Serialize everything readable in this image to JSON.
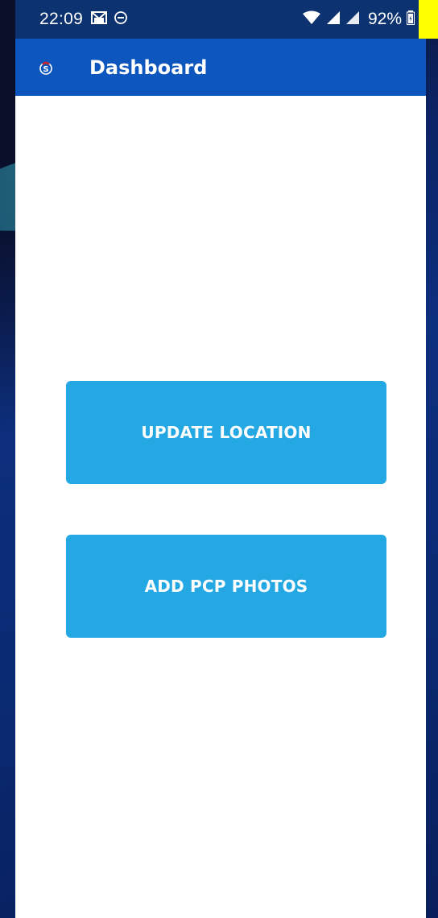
{
  "status_bar": {
    "time": "22:09",
    "battery": "92%",
    "icons": [
      "gmail-icon",
      "messenger-icon",
      "wifi-icon",
      "signal-icon",
      "signal-icon",
      "battery-icon"
    ]
  },
  "app_bar": {
    "title": "Dashboard",
    "logo_icon": "app-logo-icon",
    "color": "#0d56bd"
  },
  "buttons": {
    "update_location": "UPDATE LOCATION",
    "add_pcp_photos": "ADD PCP PHOTOS",
    "color": "#23a8e3"
  }
}
